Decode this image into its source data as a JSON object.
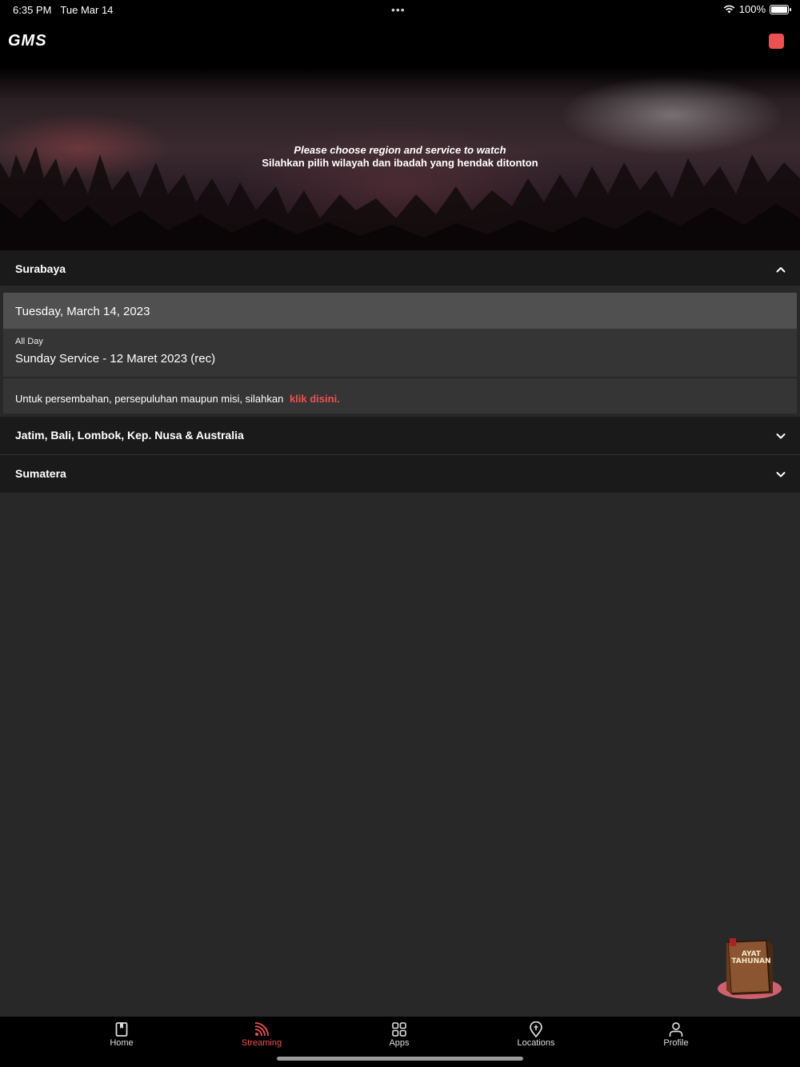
{
  "status_bar": {
    "time": "6:35 PM",
    "date": "Tue Mar 14",
    "dots": "•••",
    "battery": "100%"
  },
  "header": {
    "logo": "GMS",
    "accent_color": "#ee5050"
  },
  "hero": {
    "line_en": "Please choose region and service to watch",
    "line_id": "Silahkan pilih wilayah dan ibadah yang hendak ditonton"
  },
  "regions": [
    {
      "name": "Surabaya",
      "expanded": true,
      "date": "Tuesday, March 14, 2023",
      "time_label": "All Day",
      "service": "Sunday Service - 12 Maret 2023 (rec)",
      "donation_text": "Untuk persembahan, persepuluhan maupun misi, silahkan",
      "donation_link": "klik disini."
    },
    {
      "name": "Jatim, Bali, Lombok, Kep. Nusa & Australia",
      "expanded": false
    },
    {
      "name": "Sumatera",
      "expanded": false
    }
  ],
  "floating_badge": {
    "label_line1": "AYAT",
    "label_line2": "TAHUNAN",
    "icon": "bible-book-icon"
  },
  "tabbar": {
    "items": [
      {
        "label": "Home",
        "icon": "bookmark-icon",
        "active": false
      },
      {
        "label": "Streaming",
        "icon": "broadcast-icon",
        "active": true
      },
      {
        "label": "Apps",
        "icon": "grid-icon",
        "active": false
      },
      {
        "label": "Locations",
        "icon": "location-pin-icon",
        "active": false
      },
      {
        "label": "Profile",
        "icon": "person-icon",
        "active": false
      }
    ]
  }
}
